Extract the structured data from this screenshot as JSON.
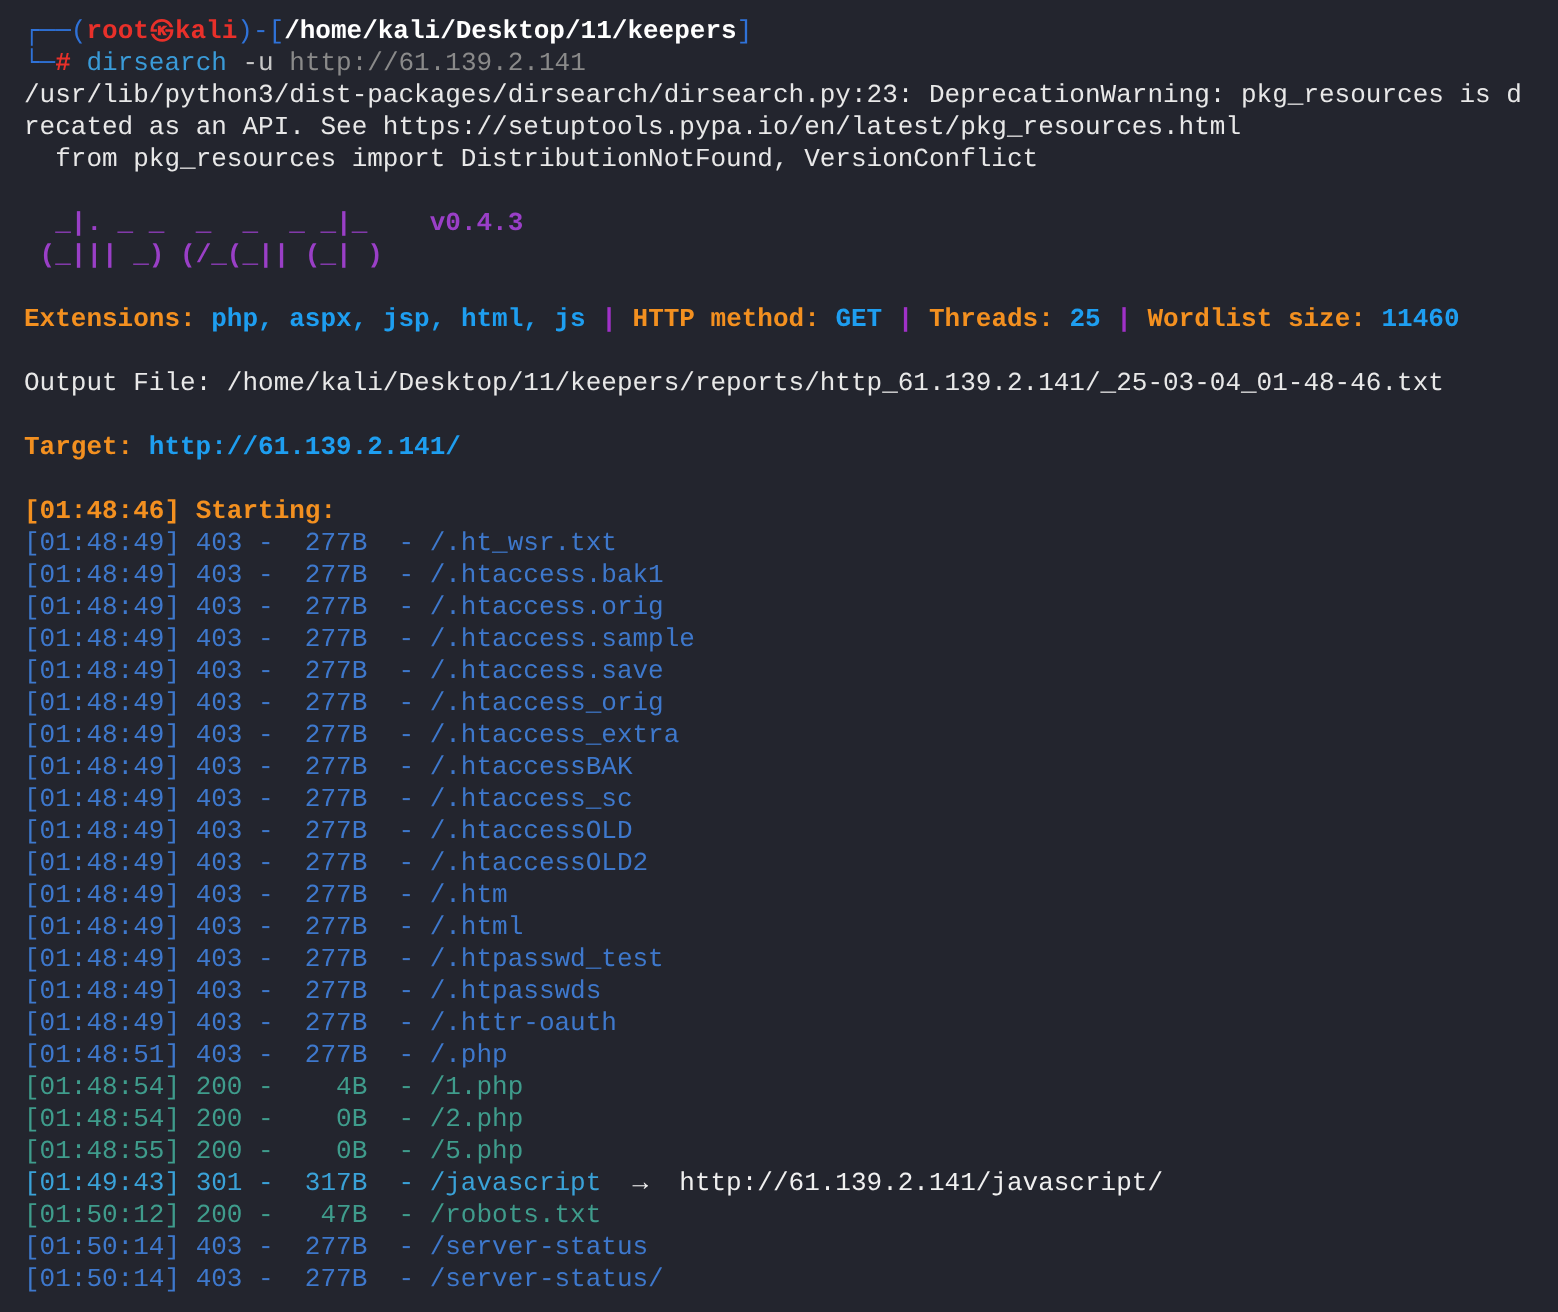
{
  "prompt": {
    "frame_left": "┌──(",
    "user": "root",
    "at": "㉿",
    "host": "kali",
    "frame_mid": ")-[",
    "path": "/home/kali/Desktop/11/keepers",
    "frame_right": "]"
  },
  "command_line": {
    "frame": "└─",
    "symbol": "#",
    "command": "dirsearch",
    "args": [
      "-u",
      "http://61.139.2.141"
    ]
  },
  "warning_lines": [
    "/usr/lib/python3/dist-packages/dirsearch/dirsearch.py:23: DeprecationWarning: pkg_resources is d",
    "recated as an API. See https://setuptools.pypa.io/en/latest/pkg_resources.html",
    "  from pkg_resources import DistributionNotFound, VersionConflict"
  ],
  "banner": {
    "art": [
      "  _|. _ _  _  _  _ _|_",
      " (_||| _) (/_(_|| (_| )"
    ],
    "version": "v0.4.3"
  },
  "config": [
    {
      "kind": "label",
      "text": "Extensions:"
    },
    {
      "kind": "value",
      "text": "php, aspx, jsp, html, js"
    },
    {
      "kind": "separator",
      "text": "|"
    },
    {
      "kind": "label",
      "text": "HTTP method:"
    },
    {
      "kind": "value",
      "text": "GET"
    },
    {
      "kind": "separator",
      "text": "|"
    },
    {
      "kind": "label",
      "text": "Threads:"
    },
    {
      "kind": "value",
      "text": "25"
    },
    {
      "kind": "separator",
      "text": "|"
    },
    {
      "kind": "label",
      "text": "Wordlist size:"
    },
    {
      "kind": "value",
      "text": "11460"
    }
  ],
  "output_file": "Output File: /home/kali/Desktop/11/keepers/reports/http_61.139.2.141/_25-03-04_01-48-46.txt",
  "target": {
    "label": "Target:",
    "url": "http://61.139.2.141/"
  },
  "starting": "[01:48:46] Starting:",
  "results": [
    {
      "kind": "forbidden",
      "text": "[01:48:49] 403 -  277B  - /.ht_wsr.txt"
    },
    {
      "kind": "forbidden",
      "text": "[01:48:49] 403 -  277B  - /.htaccess.bak1"
    },
    {
      "kind": "forbidden",
      "text": "[01:48:49] 403 -  277B  - /.htaccess.orig"
    },
    {
      "kind": "forbidden",
      "text": "[01:48:49] 403 -  277B  - /.htaccess.sample"
    },
    {
      "kind": "forbidden",
      "text": "[01:48:49] 403 -  277B  - /.htaccess.save"
    },
    {
      "kind": "forbidden",
      "text": "[01:48:49] 403 -  277B  - /.htaccess_orig"
    },
    {
      "kind": "forbidden",
      "text": "[01:48:49] 403 -  277B  - /.htaccess_extra"
    },
    {
      "kind": "forbidden",
      "text": "[01:48:49] 403 -  277B  - /.htaccessBAK"
    },
    {
      "kind": "forbidden",
      "text": "[01:48:49] 403 -  277B  - /.htaccess_sc"
    },
    {
      "kind": "forbidden",
      "text": "[01:48:49] 403 -  277B  - /.htaccessOLD"
    },
    {
      "kind": "forbidden",
      "text": "[01:48:49] 403 -  277B  - /.htaccessOLD2"
    },
    {
      "kind": "forbidden",
      "text": "[01:48:49] 403 -  277B  - /.htm"
    },
    {
      "kind": "forbidden",
      "text": "[01:48:49] 403 -  277B  - /.html"
    },
    {
      "kind": "forbidden",
      "text": "[01:48:49] 403 -  277B  - /.htpasswd_test"
    },
    {
      "kind": "forbidden",
      "text": "[01:48:49] 403 -  277B  - /.htpasswds"
    },
    {
      "kind": "forbidden",
      "text": "[01:48:49] 403 -  277B  - /.httr-oauth"
    },
    {
      "kind": "forbidden",
      "text": "[01:48:51] 403 -  277B  - /.php"
    },
    {
      "kind": "ok",
      "text": "[01:48:54] 200 -    4B  - /1.php"
    },
    {
      "kind": "ok",
      "text": "[01:48:54] 200 -    0B  - /2.php"
    },
    {
      "kind": "ok",
      "text": "[01:48:55] 200 -    0B  - /5.php"
    },
    {
      "kind": "redirect",
      "text": "[01:49:43] 301 -  317B  - /javascript",
      "redirect": "→  http://61.139.2.141/javascript/"
    },
    {
      "kind": "ok",
      "text": "[01:50:12] 200 -   47B  - /robots.txt"
    },
    {
      "kind": "forbidden",
      "text": "[01:50:14] 403 -  277B  - /server-status"
    },
    {
      "kind": "forbidden",
      "text": "[01:50:14] 403 -  277B  - /server-status/"
    }
  ]
}
